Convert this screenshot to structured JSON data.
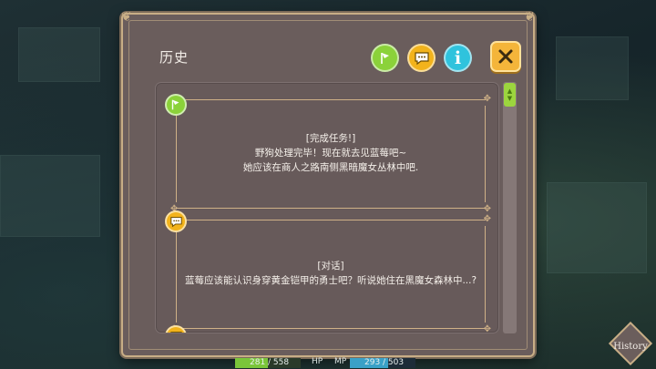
{
  "window": {
    "title": "历史"
  },
  "header_buttons": {
    "mission_icon": "mission-flag-icon",
    "chat_icon": "speech-bubble-icon",
    "info_label": "i",
    "close_icon": "close-x-icon"
  },
  "entries": [
    {
      "type": "mission",
      "icon": "mission-flag-icon",
      "lines": [
        "[完成任务!]",
        "野狗处理完毕！现在就去见蓝莓吧~",
        "她应该在商人之路南侧黑暗魔女丛林中吧."
      ]
    },
    {
      "type": "dialogue",
      "icon": "speech-bubble-icon",
      "lines": [
        "[对话]",
        "蓝莓应该能认识身穿黄金铠甲的勇士吧？听说她住在黑魔女森林中...?"
      ]
    }
  ],
  "hud": {
    "hp_value": "281 / 558",
    "hp_label": "HP",
    "hp_fraction": 0.504,
    "mp_value": "293 / 503",
    "mp_label": "MP",
    "mp_fraction": 0.583
  },
  "history_button": {
    "label": "History"
  },
  "colors": {
    "panel": "#6a5d5c",
    "frame_gold": "#c8ae86",
    "mission_green": "#8bd23a",
    "chat_orange": "#f2b31c",
    "info_cyan": "#2fc3dd",
    "close_orange": "#f4b53a"
  }
}
